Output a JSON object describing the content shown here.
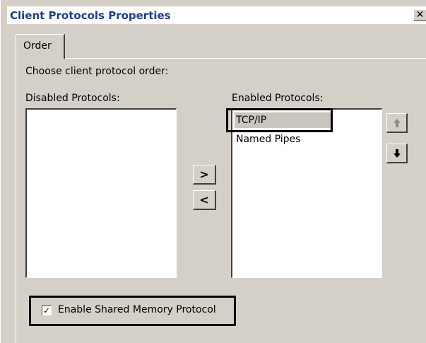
{
  "window": {
    "title": "Client Protocols Properties",
    "close_glyph": "✕"
  },
  "tabs": [
    {
      "label": "Order",
      "active": true
    }
  ],
  "order_tab": {
    "instruction": "Choose client protocol order:",
    "disabled_label": "Disabled Protocols:",
    "enabled_label": "Enabled Protocols:",
    "disabled_protocols": [],
    "enabled_protocols": [
      {
        "label": "TCP/IP",
        "selected": true
      },
      {
        "label": "Named Pipes",
        "selected": false
      }
    ],
    "move_right_glyph": ">",
    "move_left_glyph": "<",
    "move_up_glyph": "🡅",
    "move_down_glyph": "🡇",
    "shared_memory": {
      "label": "Enable Shared Memory Protocol",
      "checked": true,
      "check_glyph": "✓"
    }
  },
  "colors": {
    "title_text": "#1f3f8a",
    "face": "#d4d0c8",
    "selection": "#c9c6bf",
    "highlight_box": "#000000"
  }
}
